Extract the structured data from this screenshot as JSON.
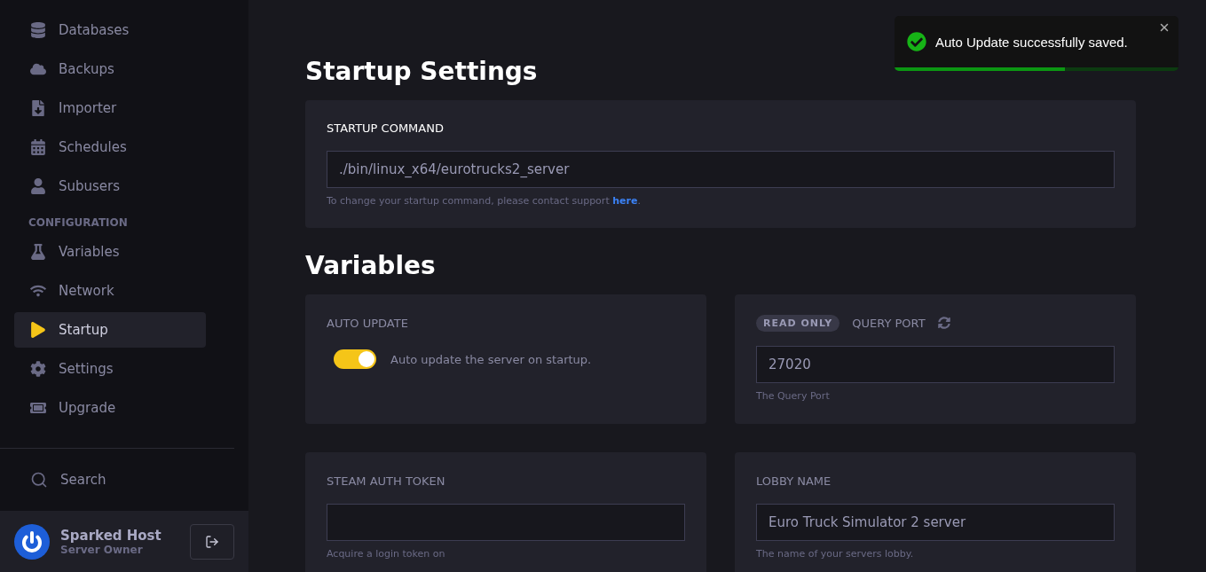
{
  "sidebar": {
    "items": [
      {
        "label": "Databases",
        "selected": false
      },
      {
        "label": "Backups",
        "selected": false
      },
      {
        "label": "Importer",
        "selected": false
      },
      {
        "label": "Schedules",
        "selected": false
      },
      {
        "label": "Subusers",
        "selected": false
      },
      {
        "kind": "heading",
        "label": "CONFIGURATION"
      },
      {
        "label": "Variables",
        "selected": false
      },
      {
        "label": "Network",
        "selected": false
      },
      {
        "label": "Startup",
        "selected": true
      },
      {
        "label": "Settings",
        "selected": false
      },
      {
        "label": "Upgrade",
        "selected": false
      }
    ],
    "search": "Search",
    "user": {
      "name": "Sparked Host",
      "role": "Server Owner"
    }
  },
  "startup": {
    "title": "Startup Settings",
    "label": "STARTUP COMMAND",
    "command": "./bin/linux_x64/eurotrucks2_server",
    "help": "To change your startup command, please contact support ",
    "link": "here",
    "help_end": "."
  },
  "variables": {
    "title": "Variables",
    "items": [
      {
        "kind": "toggle",
        "label": "AUTO UPDATE",
        "on": true,
        "description": "Auto update the server on startup."
      },
      {
        "kind": "input",
        "label": "QUERY PORT",
        "badge": "READ ONLY",
        "value": "27020",
        "description": "The Query Port"
      },
      {
        "kind": "input",
        "label": "STEAM AUTH TOKEN",
        "value": "",
        "description": "Acquire a login token on"
      },
      {
        "kind": "input",
        "label": "LOBBY NAME",
        "value": "Euro Truck Simulator 2 server",
        "description": "The name of your servers lobby."
      }
    ]
  },
  "toast": {
    "message": "Auto Update successfully saved.",
    "level": 0.6
  }
}
